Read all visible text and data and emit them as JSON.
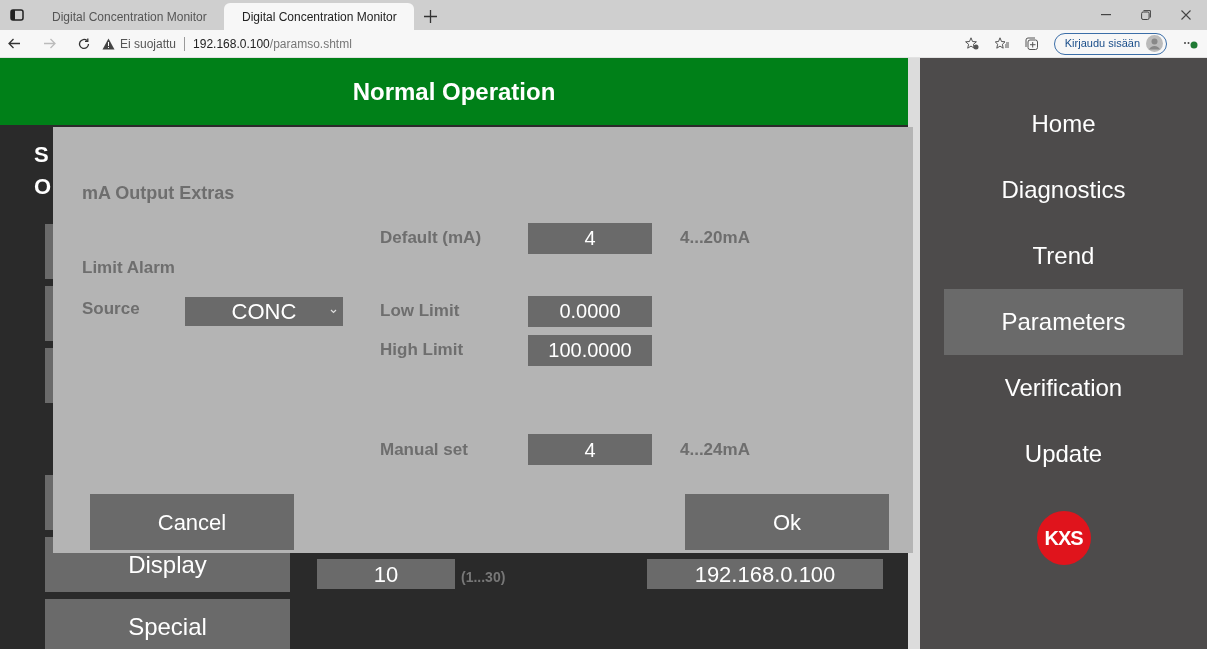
{
  "browser": {
    "tabs": [
      {
        "title": "Digital Concentration Monitor",
        "selected": false
      },
      {
        "title": "Digital Concentration Monitor",
        "selected": true
      }
    ],
    "address": {
      "security": "Ei suojattu",
      "host": "192.168.0.100",
      "path": "/paramso.shtml"
    },
    "sign_in": "Kirjaudu sisään"
  },
  "header": {
    "title": "Normal Operation"
  },
  "background": {
    "headings": [
      "S",
      "O"
    ],
    "menu_buttons": [
      {
        "kind": "button"
      },
      {
        "kind": "button"
      },
      {
        "kind": "button"
      },
      {
        "kind": "spacer"
      },
      {
        "kind": "button"
      },
      {
        "kind": "button",
        "label": "Display"
      },
      {
        "kind": "button",
        "label": "Special"
      }
    ],
    "fields": [
      {
        "value": "10",
        "hint": "(1...30)"
      },
      {
        "value": "192.168.0.100"
      }
    ]
  },
  "dialog": {
    "title": "mA Output Extras",
    "section": "Limit Alarm",
    "default": {
      "label": "Default (mA)",
      "value": "4",
      "range": "4...20mA"
    },
    "source": {
      "label": "Source",
      "value": "CONC"
    },
    "low_limit": {
      "label": "Low Limit",
      "value": "0.0000"
    },
    "high_limit": {
      "label": "High Limit",
      "value": "100.0000"
    },
    "manual": {
      "label": "Manual set",
      "value": "4",
      "range": "4...24mA"
    },
    "buttons": [
      "Cancel",
      "Ok"
    ]
  },
  "sidebar": {
    "items": [
      {
        "label": "Home",
        "selected": false
      },
      {
        "label": "Diagnostics",
        "selected": false
      },
      {
        "label": "Trend",
        "selected": false
      },
      {
        "label": "Parameters",
        "selected": true
      },
      {
        "label": "Verification",
        "selected": false
      },
      {
        "label": "Update",
        "selected": false
      }
    ],
    "logo": "KXS"
  }
}
